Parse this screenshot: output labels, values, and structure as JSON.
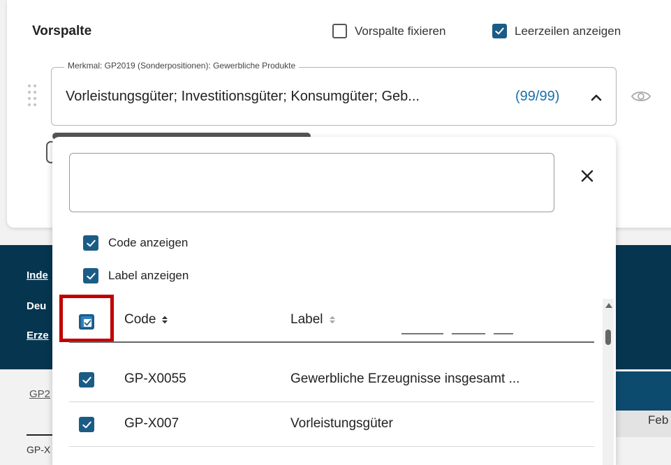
{
  "colors": {
    "accent": "#1a5c86",
    "link": "#1a6fa8",
    "band": "#05354f",
    "highlight": "#c00000"
  },
  "panel": {
    "title": "Vorspalte",
    "option_fix": {
      "label": "Vorspalte fixieren",
      "checked": false
    },
    "option_empty_rows": {
      "label": "Leerzeilen anzeigen",
      "checked": true
    },
    "feature_field": {
      "legend": "Merkmal: GP2019 (Sonderpositionen): Gewerbliche Produkte",
      "value": "Vorleistungsgüter; Investitionsgüter; Konsumgüter; Geb...",
      "count": "(99/99)",
      "toggle_icon": "chevron-up-icon"
    },
    "drag_icon": "drag-handle-icon",
    "visibility_icon": "eye-icon"
  },
  "background": {
    "link1": "Inde",
    "text2": "Deu",
    "link3": "Erze",
    "tab1": "GP2",
    "tab2": "GP-X",
    "column_header": "Feb"
  },
  "dropdown": {
    "search": {
      "value": "",
      "placeholder": ""
    },
    "close_icon": "close-icon",
    "show_code": {
      "label": "Code anzeigen",
      "checked": true
    },
    "show_label": {
      "label": "Label anzeigen",
      "checked": true
    },
    "table": {
      "select_all_state": "partial",
      "columns": [
        {
          "label": "Code",
          "sort": "sortable"
        },
        {
          "label": "Label",
          "sort": "sortable"
        }
      ],
      "rows": [
        {
          "code": "GP-X0055",
          "label": "Gewerbliche Erzeugnisse insgesamt ...",
          "checked": true
        },
        {
          "code": "GP-X007",
          "label": "Vorleistungsgüter",
          "checked": true
        }
      ]
    }
  }
}
